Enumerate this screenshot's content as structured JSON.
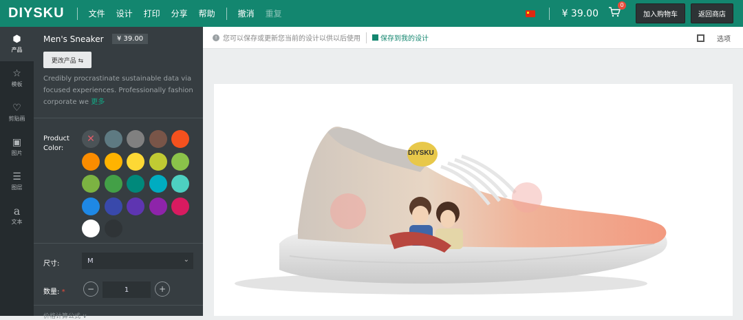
{
  "header": {
    "logo": "DIYSKU",
    "menu": [
      "文件",
      "设计",
      "打印",
      "分享",
      "帮助"
    ],
    "undo": "撤消",
    "redo": "重复",
    "price": "¥ 39.00",
    "cart_count": "0",
    "add_to_cart": "加入购物车",
    "back_to_store": "返回商店",
    "cart_icon": "shopping-cart-icon",
    "flag_icon": "china-flag-icon"
  },
  "sidebar": {
    "items": [
      {
        "label": "产品",
        "icon": "cube-icon",
        "glyph": "⬢"
      },
      {
        "label": "模板",
        "icon": "star-icon",
        "glyph": "☆"
      },
      {
        "label": "剪贴画",
        "icon": "heart-icon",
        "glyph": "♡"
      },
      {
        "label": "图片",
        "icon": "image-icon",
        "glyph": "▣"
      },
      {
        "label": "图层",
        "icon": "layers-icon",
        "glyph": "☰"
      },
      {
        "label": "文本",
        "icon": "text-icon",
        "glyph": "a"
      }
    ]
  },
  "product": {
    "name": "Men's Sneaker",
    "price": "¥ 39.00",
    "change_btn": "更改产品 ⇆",
    "description": "Credibly procrastinate sustainable data via focused experiences. Professionally fashion corporate we",
    "more": "更多",
    "color_label_1": "Product",
    "color_label_2": "Color:",
    "colors": [
      "none",
      "#5e7a82",
      "#808080",
      "#795548",
      "#f4511e",
      "#fb8c00",
      "#ffb300",
      "#fdd835",
      "#c0ca33",
      "#8bc34a",
      "#7cb342",
      "#43a047",
      "#00897b",
      "#00acc1",
      "#4dd0c1",
      "#1e88e5",
      "#3949ab",
      "#5e35b1",
      "#8e24aa",
      "#d81b60",
      "#ffffff",
      "#2f3437"
    ],
    "size_label": "尺寸:",
    "size_value": "M",
    "qty_label": "数量:",
    "qty_required": "*",
    "qty_value": "1",
    "qty_minus": "−",
    "qty_plus": "+",
    "bottom_text": "价格计算公式 ∨"
  },
  "toolbar": {
    "info": "您可以保存或更新您当前的设计以供以后使用",
    "save": "保存到我的设计",
    "options": "选项"
  },
  "canvas": {
    "shoe_brand": "DIYSKU"
  }
}
